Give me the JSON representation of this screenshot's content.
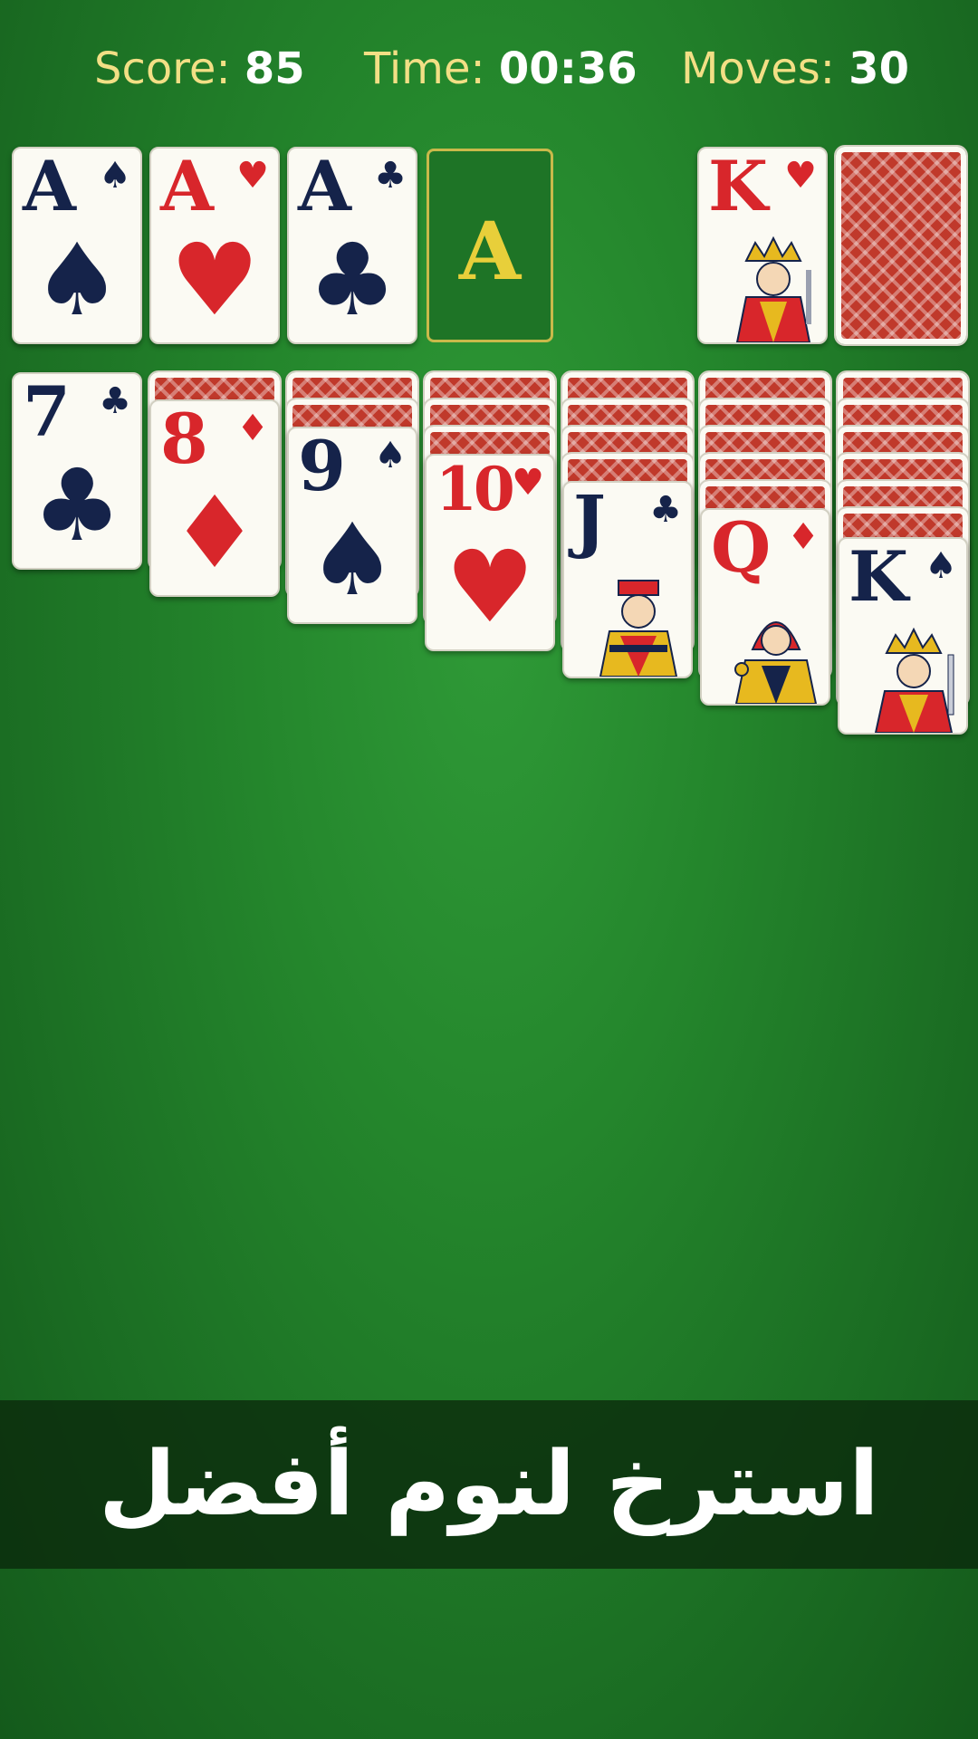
{
  "hud": {
    "score_label": "Score:",
    "score_value": "85",
    "time_label": "Time:",
    "time_value": "00:36",
    "moves_label": "Moves:",
    "moves_value": "30"
  },
  "foundations": [
    {
      "rank": "A",
      "suit": "♠",
      "color": "navy"
    },
    {
      "rank": "A",
      "suit": "♥",
      "color": "red"
    },
    {
      "rank": "A",
      "suit": "♣",
      "color": "navy"
    },
    {
      "empty_label": "A"
    }
  ],
  "waste": {
    "rank": "K",
    "suit": "♥",
    "color": "red"
  },
  "stock": {
    "face_down": true
  },
  "tableau": [
    {
      "hidden": 0,
      "rank": "7",
      "suit": "♣",
      "color": "navy"
    },
    {
      "hidden": 1,
      "rank": "8",
      "suit": "♦",
      "color": "red"
    },
    {
      "hidden": 2,
      "rank": "9",
      "suit": "♠",
      "color": "navy"
    },
    {
      "hidden": 3,
      "rank": "10",
      "suit": "♥",
      "color": "red"
    },
    {
      "hidden": 4,
      "rank": "J",
      "suit": "♣",
      "color": "navy"
    },
    {
      "hidden": 5,
      "rank": "Q",
      "suit": "♦",
      "color": "red"
    },
    {
      "hidden": 6,
      "rank": "K",
      "suit": "♠",
      "color": "navy"
    }
  ],
  "banner": {
    "text": "استرخ لنوم أفضل"
  },
  "colors": {
    "felt": "#24862c",
    "card_red": "#d8262b",
    "card_navy": "#15234a",
    "hud_label": "#f2df85",
    "card_back": "#c0392b"
  }
}
